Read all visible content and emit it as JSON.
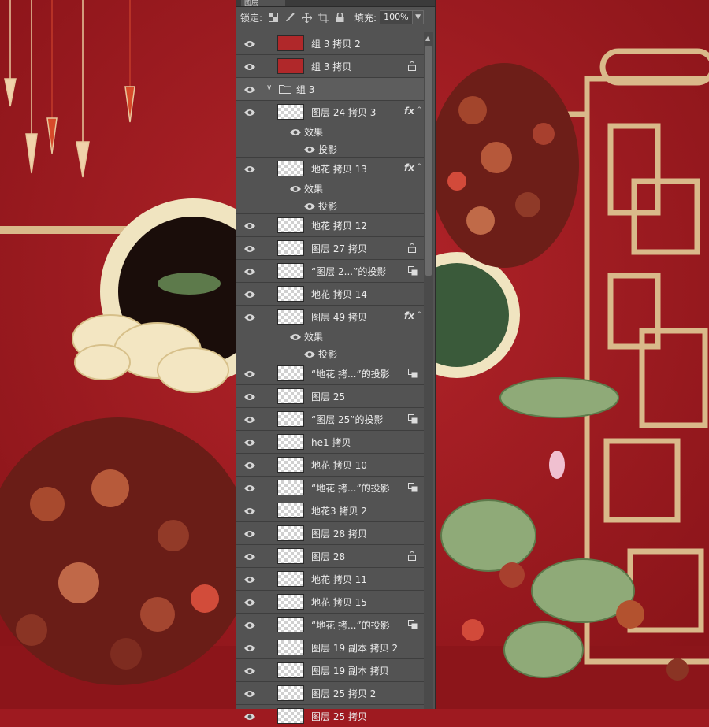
{
  "panel": {
    "tab_label": "图层",
    "lock_label": "锁定:",
    "lock_icons": [
      "transparency-lock-icon",
      "brush-lock-icon",
      "move-lock-icon",
      "artboard-lock-icon",
      "lock-all-icon"
    ],
    "fill_label": "填充:",
    "fill_value": "100%"
  },
  "layers": [
    {
      "name": "组 3 拷贝 2",
      "kind": "layer",
      "thumb": "red",
      "badge": ""
    },
    {
      "name": "组 3 拷贝",
      "kind": "layer",
      "thumb": "red",
      "badge": "lock"
    },
    {
      "name": "组 3",
      "kind": "group",
      "thumb": "",
      "badge": ""
    },
    {
      "name": "图层 24 拷贝 3",
      "kind": "layer",
      "thumb": "",
      "badge": "fx"
    },
    {
      "name": "效果",
      "kind": "effect",
      "thumb": "",
      "badge": ""
    },
    {
      "name": "投影",
      "kind": "effect-item",
      "thumb": "",
      "badge": ""
    },
    {
      "name": "地花 拷贝 13",
      "kind": "layer",
      "thumb": "",
      "badge": "fx"
    },
    {
      "name": "效果",
      "kind": "effect",
      "thumb": "",
      "badge": ""
    },
    {
      "name": "投影",
      "kind": "effect-item",
      "thumb": "",
      "badge": ""
    },
    {
      "name": "地花 拷贝 12",
      "kind": "layer",
      "thumb": "",
      "badge": ""
    },
    {
      "name": "图层 27 拷贝",
      "kind": "layer",
      "thumb": "",
      "badge": "lock"
    },
    {
      "name": "“图层 2...”的投影",
      "kind": "layer",
      "thumb": "",
      "badge": "link"
    },
    {
      "name": "地花 拷贝 14",
      "kind": "layer",
      "thumb": "",
      "badge": ""
    },
    {
      "name": "图层 49 拷贝",
      "kind": "layer",
      "thumb": "",
      "badge": "fx"
    },
    {
      "name": "效果",
      "kind": "effect",
      "thumb": "",
      "badge": ""
    },
    {
      "name": "投影",
      "kind": "effect-item",
      "thumb": "",
      "badge": ""
    },
    {
      "name": "“地花 拷...”的投影",
      "kind": "layer",
      "thumb": "",
      "badge": "link"
    },
    {
      "name": "图层 25",
      "kind": "layer",
      "thumb": "",
      "badge": ""
    },
    {
      "name": "“图层 25”的投影",
      "kind": "layer",
      "thumb": "",
      "badge": "link"
    },
    {
      "name": "he1 拷贝",
      "kind": "layer",
      "thumb": "",
      "badge": ""
    },
    {
      "name": "地花 拷贝 10",
      "kind": "layer",
      "thumb": "",
      "badge": ""
    },
    {
      "name": "“地花 拷...”的投影",
      "kind": "layer",
      "thumb": "",
      "badge": "link"
    },
    {
      "name": "地花3 拷贝 2",
      "kind": "layer",
      "thumb": "",
      "badge": ""
    },
    {
      "name": "图层 28 拷贝",
      "kind": "layer",
      "thumb": "",
      "badge": ""
    },
    {
      "name": "图层 28",
      "kind": "layer",
      "thumb": "",
      "badge": "lock"
    },
    {
      "name": "地花 拷贝 11",
      "kind": "layer",
      "thumb": "",
      "badge": ""
    },
    {
      "name": "地花 拷贝 15",
      "kind": "layer",
      "thumb": "",
      "badge": ""
    },
    {
      "name": "“地花 拷...”的投影",
      "kind": "layer",
      "thumb": "",
      "badge": "link"
    },
    {
      "name": "图层 19 副本 拷贝 2",
      "kind": "layer",
      "thumb": "",
      "badge": ""
    },
    {
      "name": "图层 19 副本 拷贝",
      "kind": "layer",
      "thumb": "",
      "badge": ""
    },
    {
      "name": "图层 25 拷贝 2",
      "kind": "layer",
      "thumb": "",
      "badge": ""
    },
    {
      "name": "图层 25 拷贝",
      "kind": "layer",
      "thumb": "",
      "badge": ""
    }
  ],
  "colors": {
    "background_red": "#9e1a20",
    "panel_gray": "#535353",
    "gold": "#d9b98a",
    "cream": "#f0e4c0"
  }
}
